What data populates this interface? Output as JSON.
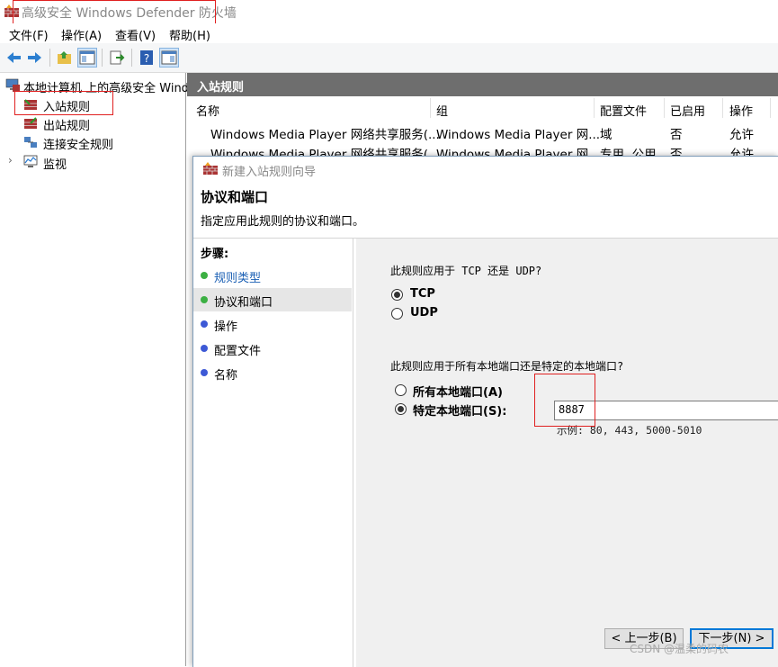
{
  "window": {
    "title": "高级安全 Windows Defender 防火墙"
  },
  "menu": [
    "文件(F)",
    "操作(A)",
    "查看(V)",
    "帮助(H)"
  ],
  "tree": {
    "root": "本地计算机 上的高级安全 Windows Defender",
    "items": [
      "入站规则",
      "出站规则",
      "连接安全规则",
      "监视"
    ]
  },
  "inbound": {
    "header": "入站规则",
    "columns": [
      "名称",
      "组",
      "配置文件",
      "已启用",
      "操作"
    ],
    "rows": [
      {
        "name": "Windows Media Player 网络共享服务(...",
        "group": "Windows Media Player 网...",
        "profile": "域",
        "enabled": "否",
        "action": "允许"
      },
      {
        "name": "Windows Media Player 网络共享服务(...",
        "group": "Windows Media Player 网...",
        "profile": "专用, 公用",
        "enabled": "否",
        "action": "允许"
      }
    ]
  },
  "wizard": {
    "title": "新建入站规则向导",
    "heading": "协议和端口",
    "subheading": "指定应用此规则的协议和端口。",
    "steps_title": "步骤:",
    "steps": [
      "规则类型",
      "协议和端口",
      "操作",
      "配置文件",
      "名称"
    ],
    "protocol_question": "此规则应用于 TCP 还是 UDP?",
    "protocol_options": [
      "TCP",
      "UDP"
    ],
    "port_question": "此规则应用于所有本地端口还是特定的本地端口?",
    "port_options": [
      "所有本地端口(A)",
      "特定本地端口(S):"
    ],
    "port_value": "8887",
    "port_example": "示例: 80, 443, 5000-5010",
    "back_button": "< 上一步(B)",
    "next_button": "下一步(N) >"
  },
  "watermark": "CSDN @温柔的码农",
  "colors": {
    "highlight_box": "#e02020",
    "panel_header": "#6e6e6e",
    "step_done": "#3cb043",
    "step_pending": "#3d59d6"
  }
}
